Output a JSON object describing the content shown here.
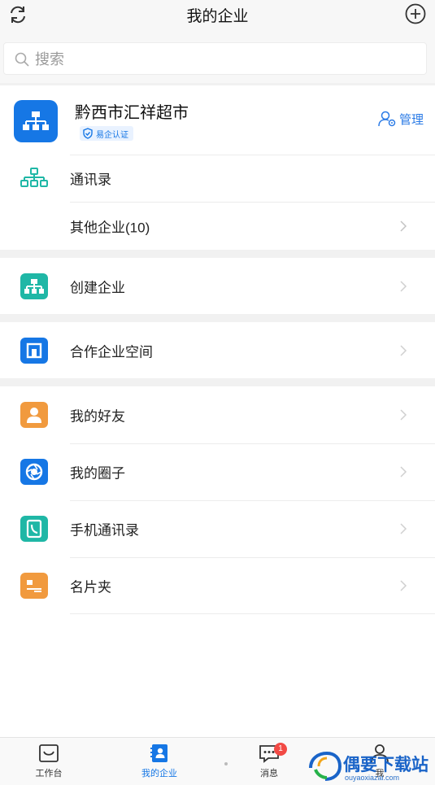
{
  "header": {
    "title": "我的企业"
  },
  "search": {
    "placeholder": "搜索"
  },
  "company": {
    "name": "黔西市汇祥超市",
    "badge": "易企认证",
    "manage_label": "管理"
  },
  "company_rows": [
    {
      "label": "通讯录"
    },
    {
      "label": "其他企业(10)"
    }
  ],
  "create": {
    "label": "创建企业"
  },
  "coop": {
    "label": "合作企业空间"
  },
  "social_rows": [
    {
      "label": "我的好友"
    },
    {
      "label": "我的圈子"
    },
    {
      "label": "手机通讯录"
    },
    {
      "label": "名片夹"
    }
  ],
  "tabbar": {
    "tabs": [
      {
        "label": "工作台"
      },
      {
        "label": "我的企业"
      },
      {
        "label": "消息",
        "badge": "1"
      },
      {
        "label": "我"
      }
    ]
  },
  "watermark": {
    "title": "偶要下载站",
    "sub": "ouyaoxiazai.com"
  },
  "colors": {
    "accent": "#1677e5",
    "teal": "#1fb7a6",
    "orange": "#f19a3e",
    "badge_red": "#f24a45"
  }
}
